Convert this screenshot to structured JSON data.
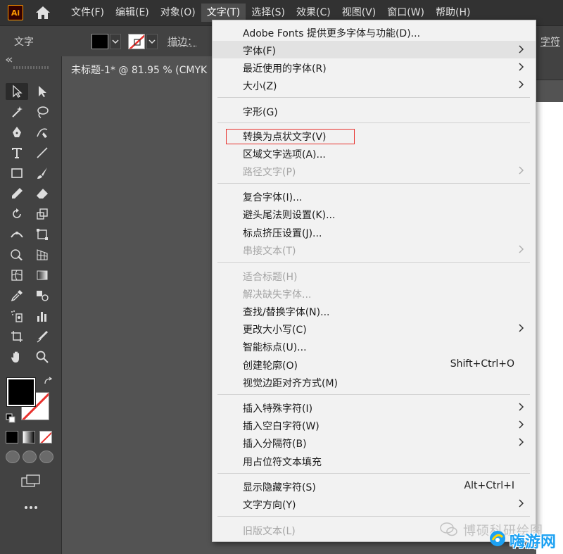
{
  "app": {
    "logo_text": "Ai",
    "menus": [
      "文件(F)",
      "编辑(E)",
      "对象(O)",
      "文字(T)",
      "选择(S)",
      "效果(C)",
      "视图(V)",
      "窗口(W)",
      "帮助(H)"
    ],
    "active_menu_index": 3
  },
  "controlbar": {
    "label": "文字",
    "stroke_label": "描边：",
    "right_label": "字符"
  },
  "document": {
    "tab_title": "未标题-1* @ 81.95 % (CMYK"
  },
  "dropdown": {
    "items": [
      {
        "label": "Adobe Fonts 提供更多字体与功能(D)...",
        "submenu": false,
        "disabled": false,
        "shortcut": ""
      },
      {
        "label": "字体(F)",
        "submenu": true,
        "disabled": false,
        "shortcut": "",
        "highlighted": true
      },
      {
        "label": "最近使用的字体(R)",
        "submenu": true,
        "disabled": false,
        "shortcut": ""
      },
      {
        "label": "大小(Z)",
        "submenu": true,
        "disabled": false,
        "shortcut": ""
      },
      {
        "label": "字形(G)",
        "submenu": false,
        "disabled": false,
        "shortcut": ""
      },
      {
        "label": "转换为点状文字(V)",
        "submenu": false,
        "disabled": false,
        "shortcut": "",
        "marked": true
      },
      {
        "label": "区域文字选项(A)...",
        "submenu": false,
        "disabled": false,
        "shortcut": ""
      },
      {
        "label": "路径文字(P)",
        "submenu": true,
        "disabled": true,
        "shortcut": ""
      },
      {
        "label": "复合字体(I)...",
        "submenu": false,
        "disabled": false,
        "shortcut": ""
      },
      {
        "label": "避头尾法则设置(K)...",
        "submenu": false,
        "disabled": false,
        "shortcut": ""
      },
      {
        "label": "标点挤压设置(J)...",
        "submenu": false,
        "disabled": false,
        "shortcut": ""
      },
      {
        "label": "串接文本(T)",
        "submenu": true,
        "disabled": true,
        "shortcut": ""
      },
      {
        "label": "适合标题(H)",
        "submenu": false,
        "disabled": true,
        "shortcut": ""
      },
      {
        "label": "解决缺失字体...",
        "submenu": false,
        "disabled": true,
        "shortcut": ""
      },
      {
        "label": "查找/替换字体(N)...",
        "submenu": false,
        "disabled": false,
        "shortcut": ""
      },
      {
        "label": "更改大小写(C)",
        "submenu": true,
        "disabled": false,
        "shortcut": ""
      },
      {
        "label": "智能标点(U)...",
        "submenu": false,
        "disabled": false,
        "shortcut": ""
      },
      {
        "label": "创建轮廓(O)",
        "submenu": false,
        "disabled": false,
        "shortcut": "Shift+Ctrl+O"
      },
      {
        "label": "视觉边距对齐方式(M)",
        "submenu": false,
        "disabled": false,
        "shortcut": ""
      },
      {
        "label": "插入特殊字符(I)",
        "submenu": true,
        "disabled": false,
        "shortcut": ""
      },
      {
        "label": "插入空白字符(W)",
        "submenu": true,
        "disabled": false,
        "shortcut": ""
      },
      {
        "label": "插入分隔符(B)",
        "submenu": true,
        "disabled": false,
        "shortcut": ""
      },
      {
        "label": "用占位符文本填充",
        "submenu": false,
        "disabled": false,
        "shortcut": ""
      },
      {
        "label": "显示隐藏字符(S)",
        "submenu": false,
        "disabled": false,
        "shortcut": "Alt+Ctrl+I"
      },
      {
        "label": "文字方向(Y)",
        "submenu": true,
        "disabled": false,
        "shortcut": ""
      },
      {
        "label": "旧版文本(L)",
        "submenu": false,
        "disabled": true,
        "shortcut": ""
      }
    ]
  },
  "watermark": {
    "text": "博硕科研绘图",
    "brand": "嗨游网"
  },
  "colors": {
    "accent_red": "#e8312d",
    "ai_orange": "#ff9a00",
    "brand_blue": "#1da1f2"
  }
}
